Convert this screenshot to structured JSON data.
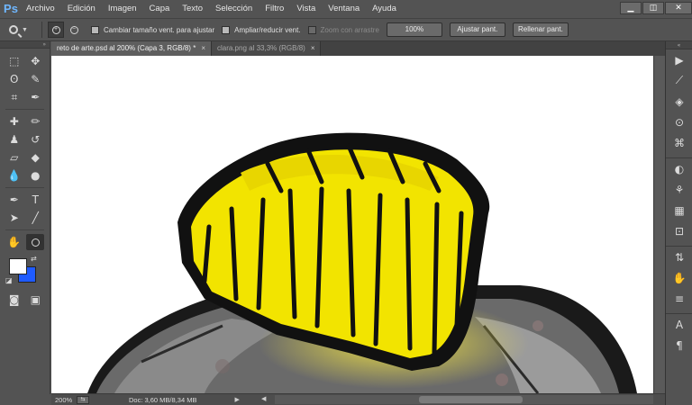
{
  "app": {
    "logo": "Ps"
  },
  "menu": [
    "Archivo",
    "Edición",
    "Imagen",
    "Capa",
    "Texto",
    "Selección",
    "Filtro",
    "Vista",
    "Ventana",
    "Ayuda"
  ],
  "window_controls": {
    "minimize": "▁",
    "restore": "◫",
    "close": "✕"
  },
  "options": {
    "resize_windows_label": "Cambiar tamaño vent. para ajustar",
    "zoom_all_windows_label": "Ampliar/reducir vent.",
    "scrubby_zoom_label": "Zoom con arrastre",
    "btn_100": "100%",
    "btn_fit": "Ajustar pant.",
    "btn_fill": "Rellenar pant."
  },
  "tabs": [
    {
      "label": "reto de arte.psd al 200% (Capa 3, RGB/8) *",
      "close": "×",
      "active": true
    },
    {
      "label": "clara.png al 33,3% (RGB/8)",
      "close": "×",
      "active": false
    }
  ],
  "status": {
    "zoom": "200%",
    "doc": "Doc: 3,60 MB/8,34 MB",
    "arrow": "▶"
  },
  "scroll_arrows": {
    "left": "◀",
    "right": "▶"
  },
  "colors": {
    "foreground": "#ffffff",
    "background": "#1f5bff",
    "accent": "#6fb7ff"
  },
  "tool_icons": {
    "marquee": "⬚",
    "move": "✥",
    "lasso": "ʘ",
    "quick_select": "✎",
    "crop": "⌗",
    "eyedropper": "✒",
    "healing": "✚",
    "brush": "✏",
    "stamp": "♟",
    "history_brush": "↺",
    "eraser": "▱",
    "bucket": "◆",
    "blur": "💧",
    "dodge": "●",
    "pen": "✒",
    "type": "T",
    "path_select": "➤",
    "line": "╱",
    "hand": "✋",
    "zoom": "🔍",
    "swap": "⇄",
    "default": "◪",
    "quickmask": "◙",
    "screen_mode": "▣"
  },
  "dock_icons": [
    "▶",
    "⟋",
    "◈",
    "⊙",
    "⌘",
    "◐",
    "⚘",
    "▦",
    "⊡",
    "⇅",
    "✋",
    "≡",
    "A",
    "¶"
  ]
}
